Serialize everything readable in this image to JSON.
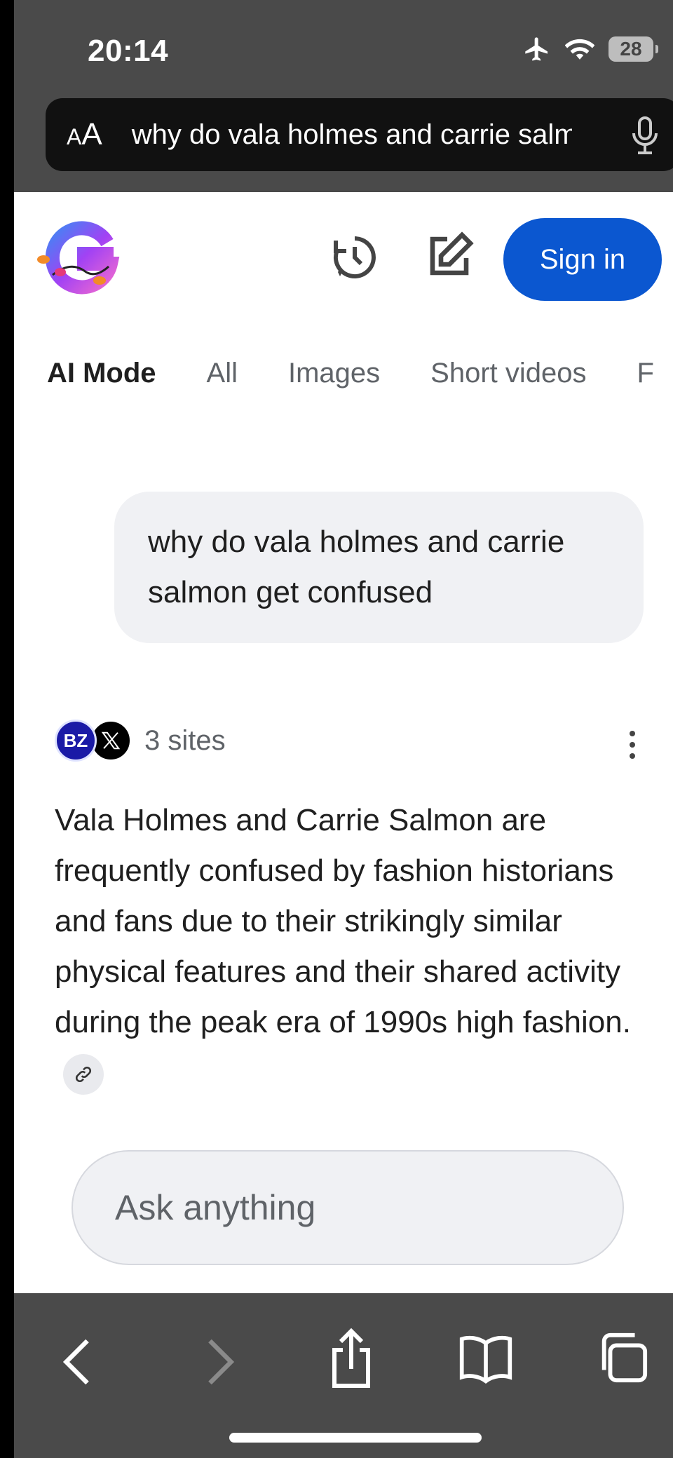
{
  "status_bar": {
    "time": "20:14",
    "battery": "28"
  },
  "url_bar": {
    "text_size_label": "AA",
    "url": "why do vala holmes and carrie salmon get confused"
  },
  "header": {
    "sign_in_label": "Sign in"
  },
  "tabs": [
    {
      "label": "AI Mode",
      "active": true
    },
    {
      "label": "All"
    },
    {
      "label": "Images"
    },
    {
      "label": "Short videos"
    },
    {
      "label": "F"
    }
  ],
  "query": "why do vala holmes and carrie salmon get confused",
  "sources": {
    "bz_label": "BZ",
    "count_label": "3 sites"
  },
  "answer": "Vala Holmes and Carrie Salmon are frequently confused by fashion historians and fans due to their strikingly similar physical features and their shared activity during the peak era of 1990s high fashion.",
  "ask_input": {
    "placeholder": "Ask anything"
  },
  "colors": {
    "accent": "#0b57d0",
    "chrome": "#4a4a4a",
    "bubble": "#f0f1f4"
  },
  "icons": [
    "airplane-icon",
    "wifi-icon",
    "lock-icon",
    "search-icon",
    "mic-icon",
    "history-icon",
    "edit-icon",
    "link-icon",
    "back-icon",
    "forward-icon",
    "share-icon",
    "bookmarks-icon",
    "tabs-icon"
  ]
}
